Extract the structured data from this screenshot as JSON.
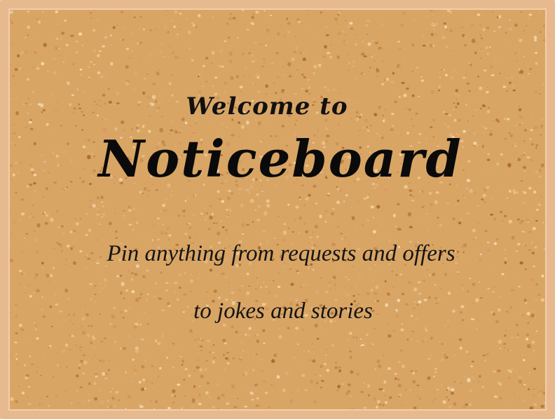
{
  "board": {
    "welcome": "Welcome to",
    "title": "Noticeboard",
    "subtitle_line1": "Pin anything from requests and offers",
    "subtitle_line2": "to jokes and stories"
  },
  "colors": {
    "frame": "#e7b98f",
    "frame_highlight": "#f2cfa8",
    "cork_base": "#d9a565",
    "text": "#111111"
  }
}
